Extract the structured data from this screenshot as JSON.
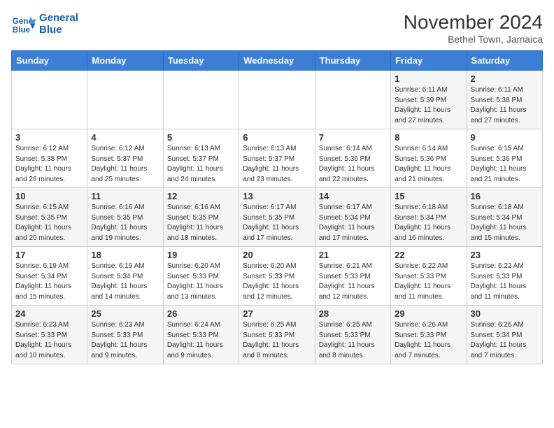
{
  "header": {
    "logo_line1": "General",
    "logo_line2": "Blue",
    "month": "November 2024",
    "location": "Bethel Town, Jamaica"
  },
  "days_of_week": [
    "Sunday",
    "Monday",
    "Tuesday",
    "Wednesday",
    "Thursday",
    "Friday",
    "Saturday"
  ],
  "weeks": [
    [
      {
        "num": "",
        "info": ""
      },
      {
        "num": "",
        "info": ""
      },
      {
        "num": "",
        "info": ""
      },
      {
        "num": "",
        "info": ""
      },
      {
        "num": "",
        "info": ""
      },
      {
        "num": "1",
        "info": "Sunrise: 6:11 AM\nSunset: 5:39 PM\nDaylight: 11 hours and 27 minutes."
      },
      {
        "num": "2",
        "info": "Sunrise: 6:11 AM\nSunset: 5:38 PM\nDaylight: 11 hours and 27 minutes."
      }
    ],
    [
      {
        "num": "3",
        "info": "Sunrise: 6:12 AM\nSunset: 5:38 PM\nDaylight: 11 hours and 26 minutes."
      },
      {
        "num": "4",
        "info": "Sunrise: 6:12 AM\nSunset: 5:37 PM\nDaylight: 11 hours and 25 minutes."
      },
      {
        "num": "5",
        "info": "Sunrise: 6:13 AM\nSunset: 5:37 PM\nDaylight: 11 hours and 24 minutes."
      },
      {
        "num": "6",
        "info": "Sunrise: 6:13 AM\nSunset: 5:37 PM\nDaylight: 11 hours and 23 minutes."
      },
      {
        "num": "7",
        "info": "Sunrise: 6:14 AM\nSunset: 5:36 PM\nDaylight: 11 hours and 22 minutes."
      },
      {
        "num": "8",
        "info": "Sunrise: 6:14 AM\nSunset: 5:36 PM\nDaylight: 11 hours and 21 minutes."
      },
      {
        "num": "9",
        "info": "Sunrise: 6:15 AM\nSunset: 5:36 PM\nDaylight: 11 hours and 21 minutes."
      }
    ],
    [
      {
        "num": "10",
        "info": "Sunrise: 6:15 AM\nSunset: 5:35 PM\nDaylight: 11 hours and 20 minutes."
      },
      {
        "num": "11",
        "info": "Sunrise: 6:16 AM\nSunset: 5:35 PM\nDaylight: 11 hours and 19 minutes."
      },
      {
        "num": "12",
        "info": "Sunrise: 6:16 AM\nSunset: 5:35 PM\nDaylight: 11 hours and 18 minutes."
      },
      {
        "num": "13",
        "info": "Sunrise: 6:17 AM\nSunset: 5:35 PM\nDaylight: 11 hours and 17 minutes."
      },
      {
        "num": "14",
        "info": "Sunrise: 6:17 AM\nSunset: 5:34 PM\nDaylight: 11 hours and 17 minutes."
      },
      {
        "num": "15",
        "info": "Sunrise: 6:18 AM\nSunset: 5:34 PM\nDaylight: 11 hours and 16 minutes."
      },
      {
        "num": "16",
        "info": "Sunrise: 6:18 AM\nSunset: 5:34 PM\nDaylight: 11 hours and 15 minutes."
      }
    ],
    [
      {
        "num": "17",
        "info": "Sunrise: 6:19 AM\nSunset: 5:34 PM\nDaylight: 11 hours and 15 minutes."
      },
      {
        "num": "18",
        "info": "Sunrise: 6:19 AM\nSunset: 5:34 PM\nDaylight: 11 hours and 14 minutes."
      },
      {
        "num": "19",
        "info": "Sunrise: 6:20 AM\nSunset: 5:33 PM\nDaylight: 11 hours and 13 minutes."
      },
      {
        "num": "20",
        "info": "Sunrise: 6:20 AM\nSunset: 5:33 PM\nDaylight: 11 hours and 12 minutes."
      },
      {
        "num": "21",
        "info": "Sunrise: 6:21 AM\nSunset: 5:33 PM\nDaylight: 11 hours and 12 minutes."
      },
      {
        "num": "22",
        "info": "Sunrise: 6:22 AM\nSunset: 5:33 PM\nDaylight: 11 hours and 11 minutes."
      },
      {
        "num": "23",
        "info": "Sunrise: 6:22 AM\nSunset: 5:33 PM\nDaylight: 11 hours and 11 minutes."
      }
    ],
    [
      {
        "num": "24",
        "info": "Sunrise: 6:23 AM\nSunset: 5:33 PM\nDaylight: 11 hours and 10 minutes."
      },
      {
        "num": "25",
        "info": "Sunrise: 6:23 AM\nSunset: 5:33 PM\nDaylight: 11 hours and 9 minutes."
      },
      {
        "num": "26",
        "info": "Sunrise: 6:24 AM\nSunset: 5:33 PM\nDaylight: 11 hours and 9 minutes."
      },
      {
        "num": "27",
        "info": "Sunrise: 6:25 AM\nSunset: 5:33 PM\nDaylight: 11 hours and 8 minutes."
      },
      {
        "num": "28",
        "info": "Sunrise: 6:25 AM\nSunset: 5:33 PM\nDaylight: 11 hours and 8 minutes."
      },
      {
        "num": "29",
        "info": "Sunrise: 6:26 AM\nSunset: 5:33 PM\nDaylight: 11 hours and 7 minutes."
      },
      {
        "num": "30",
        "info": "Sunrise: 6:26 AM\nSunset: 5:34 PM\nDaylight: 11 hours and 7 minutes."
      }
    ]
  ]
}
